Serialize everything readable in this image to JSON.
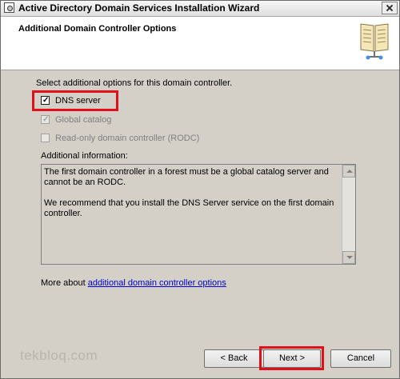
{
  "window": {
    "title": "Active Directory Domain Services Installation Wizard"
  },
  "header": {
    "heading": "Additional Domain Controller Options",
    "icon": "book-icon"
  },
  "body": {
    "intro": "Select additional options for this domain controller.",
    "options": [
      {
        "label": "DNS server",
        "checked": true,
        "enabled": true,
        "highlighted": true
      },
      {
        "label": "Global catalog",
        "checked": true,
        "enabled": false
      },
      {
        "label": "Read-only domain controller (RODC)",
        "checked": false,
        "enabled": false
      }
    ],
    "additional_label": "Additional information:",
    "info_paragraphs": [
      "The first domain controller in a forest must be a global catalog server and cannot be an RODC.",
      "We recommend that you install the DNS Server service on the first domain controller."
    ],
    "more_prefix": "More about ",
    "more_link": "additional domain controller options"
  },
  "watermark": "tekbloq.com",
  "buttons": {
    "back": "< Back",
    "next": "Next >",
    "cancel": "Cancel"
  },
  "colors": {
    "highlight": "#e0101a",
    "link": "#0000cc",
    "dialog_bg": "#d4d0c8"
  }
}
